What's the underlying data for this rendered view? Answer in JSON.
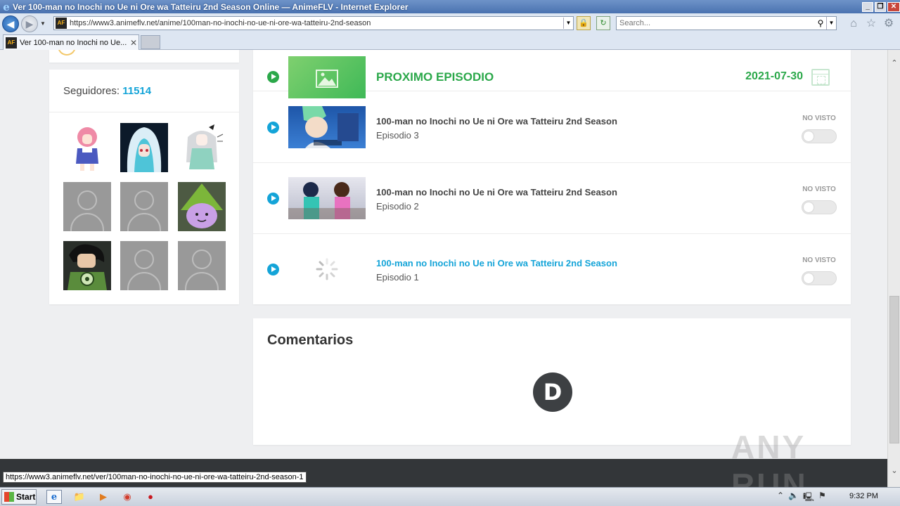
{
  "window": {
    "title": "Ver 100-man no Inochi no Ue ni Ore wa Tatteiru 2nd Season Online — AnimeFLV - Internet Explorer",
    "controls": [
      "_",
      "❐",
      "✕"
    ]
  },
  "addressbar": {
    "url": "https://www3.animeflv.net/anime/100man-no-inochi-no-ue-ni-ore-wa-tatteiru-2nd-season",
    "search_placeholder": "Search..."
  },
  "tab": {
    "favicon_text": "AF",
    "label": "Ver 100-man no Inochi no Ue...",
    "close": "✕"
  },
  "sidebar": {
    "followers_label": "Seguidores:",
    "followers_count": "11514"
  },
  "episodes": {
    "next_label": "PROXIMO EPISODIO",
    "next_date": "2021-07-30",
    "items": [
      {
        "title": "100-man no Inochi no Ue ni Ore wa Tatteiru 2nd Season",
        "episode": "Episodio 3",
        "status": "NO VISTO"
      },
      {
        "title": "100-man no Inochi no Ue ni Ore wa Tatteiru 2nd Season",
        "episode": "Episodio 2",
        "status": "NO VISTO"
      },
      {
        "title": "100-man no Inochi no Ue ni Ore wa Tatteiru 2nd Season",
        "episode": "Episodio 1",
        "status": "NO VISTO"
      }
    ]
  },
  "comments": {
    "title": "Comentarios",
    "disqus_letter": "D"
  },
  "watermark": "ANY RUN",
  "status_url": "https://www3.animeflv.net/ver/100man-no-inochi-no-ue-ni-ore-wa-tatteiru-2nd-season-1",
  "taskbar": {
    "start_label": "Start",
    "clock": "9:32 PM"
  },
  "colors": {
    "accent_blue": "#14a4d8",
    "next_green": "#2ba84a",
    "footer": "#333639"
  }
}
